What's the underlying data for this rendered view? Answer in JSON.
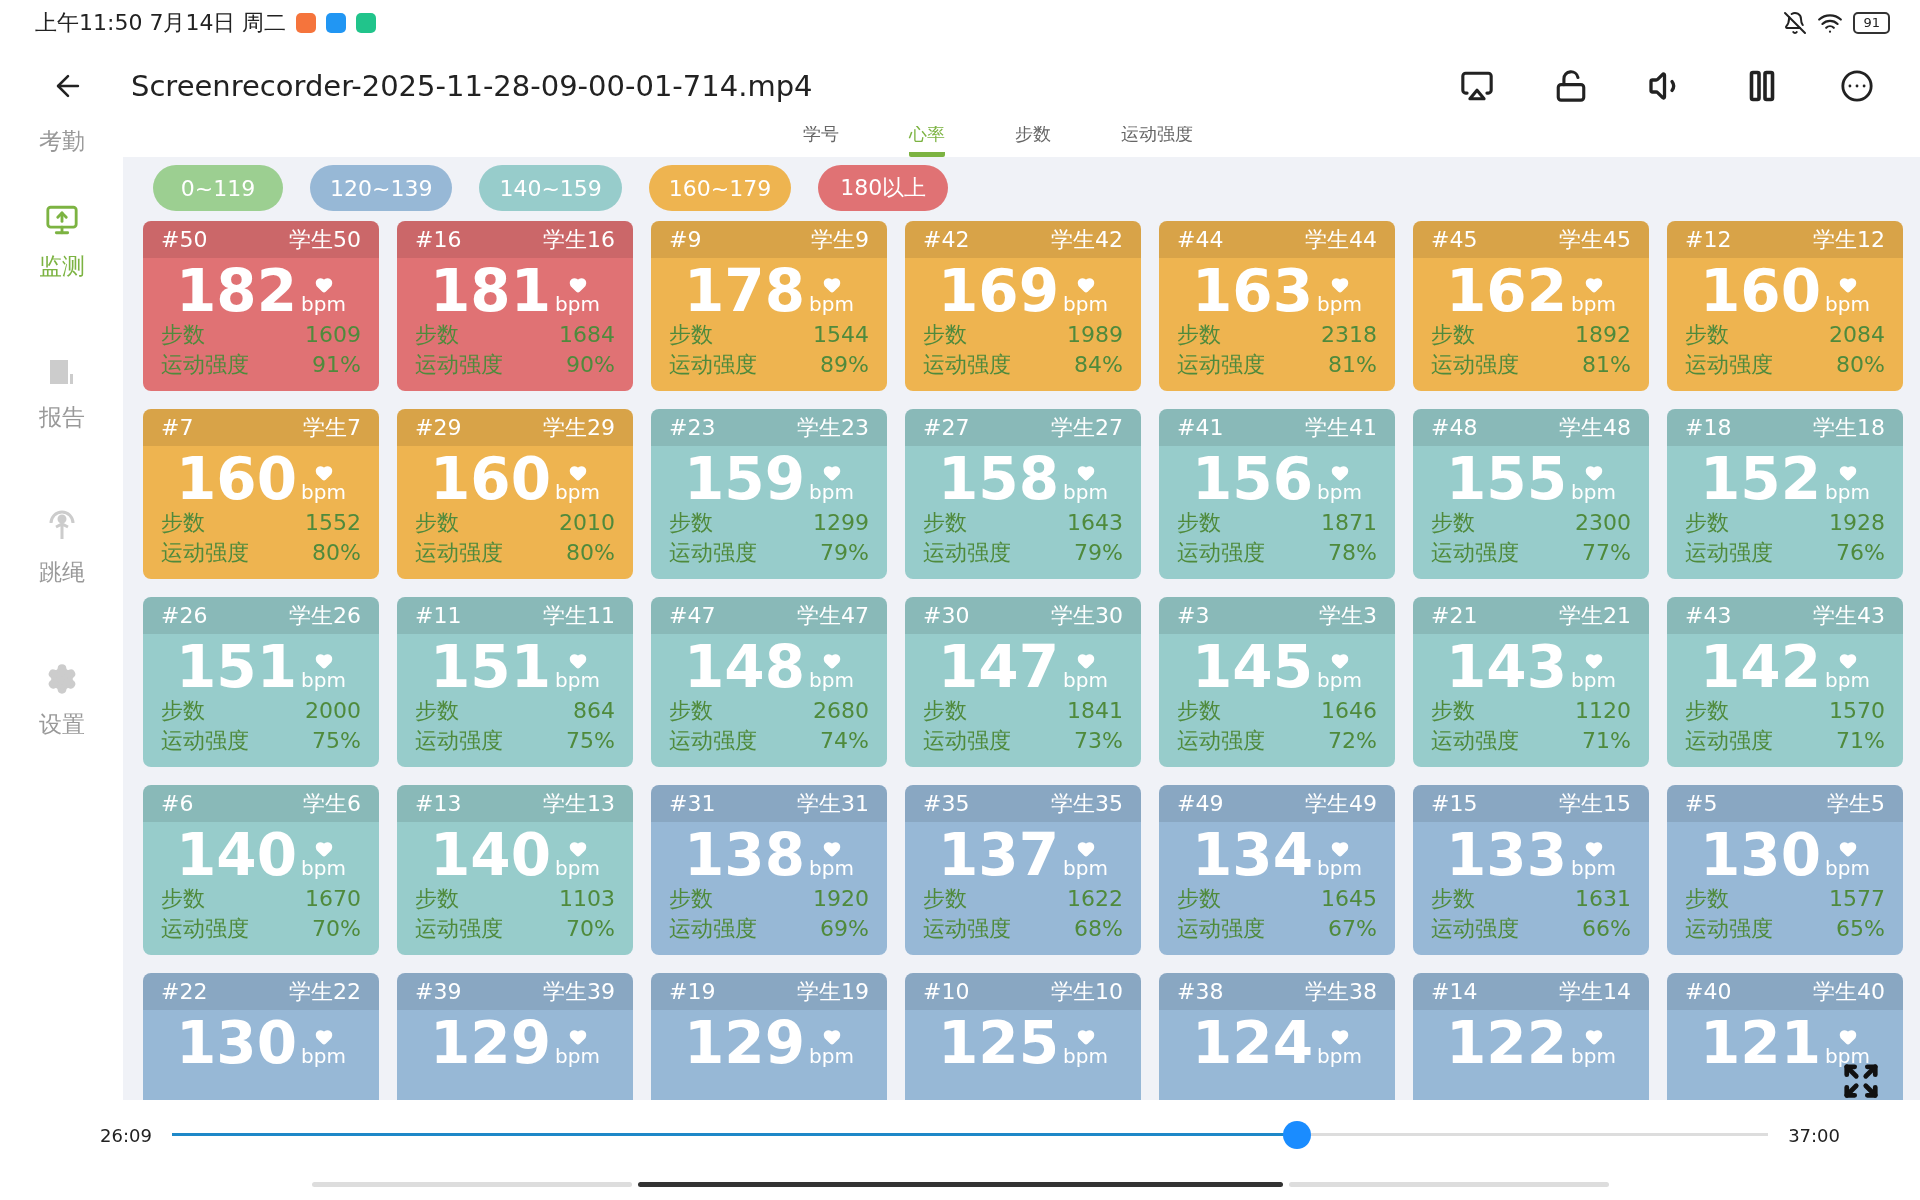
{
  "status_bar": {
    "time": "上午11:50 7月14日 周二",
    "battery": "91"
  },
  "player": {
    "title": "Screenrecorder-2025-11-28-09-00-01-714.mp4",
    "elapsed": "26:09",
    "duration": "37:00",
    "level": 0.705
  },
  "sidebar": {
    "items": [
      {
        "label": "考勤",
        "selected": false
      },
      {
        "label": "监测",
        "selected": true
      },
      {
        "label": "报告",
        "selected": false
      },
      {
        "label": "跳绳",
        "selected": false
      },
      {
        "label": "设置",
        "selected": false
      }
    ]
  },
  "tabs": [
    {
      "label": "学号",
      "selected": false
    },
    {
      "label": "心率",
      "selected": true
    },
    {
      "label": "步数",
      "selected": false
    },
    {
      "label": "运动强度",
      "selected": false
    }
  ],
  "legend": [
    {
      "label": "0~119",
      "color": "#9ccf91"
    },
    {
      "label": "120~139",
      "color": "#97b8d6"
    },
    {
      "label": "140~159",
      "color": "#97cccb"
    },
    {
      "label": "160~179",
      "color": "#eeb450"
    },
    {
      "label": "180以上",
      "color": "#e07274"
    }
  ],
  "cards": [
    {
      "id": "#50",
      "name": "学生50",
      "bpm": "182",
      "unit": "bpm",
      "steps_label": "步数",
      "steps": "1609",
      "intensity_label": "运动强度",
      "intensity": "91%",
      "color": "#e07274"
    },
    {
      "id": "#16",
      "name": "学生16",
      "bpm": "181",
      "unit": "bpm",
      "steps_label": "步数",
      "steps": "1684",
      "intensity_label": "运动强度",
      "intensity": "90%",
      "color": "#e07274"
    },
    {
      "id": "#9",
      "name": "学生9",
      "bpm": "178",
      "unit": "bpm",
      "steps_label": "步数",
      "steps": "1544",
      "intensity_label": "运动强度",
      "intensity": "89%",
      "color": "#eeb450"
    },
    {
      "id": "#42",
      "name": "学生42",
      "bpm": "169",
      "unit": "bpm",
      "steps_label": "步数",
      "steps": "1989",
      "intensity_label": "运动强度",
      "intensity": "84%",
      "color": "#eeb450"
    },
    {
      "id": "#44",
      "name": "学生44",
      "bpm": "163",
      "unit": "bpm",
      "steps_label": "步数",
      "steps": "2318",
      "intensity_label": "运动强度",
      "intensity": "81%",
      "color": "#eeb450"
    },
    {
      "id": "#45",
      "name": "学生45",
      "bpm": "162",
      "unit": "bpm",
      "steps_label": "步数",
      "steps": "1892",
      "intensity_label": "运动强度",
      "intensity": "81%",
      "color": "#eeb450"
    },
    {
      "id": "#12",
      "name": "学生12",
      "bpm": "160",
      "unit": "bpm",
      "steps_label": "步数",
      "steps": "2084",
      "intensity_label": "运动强度",
      "intensity": "80%",
      "color": "#eeb450"
    },
    {
      "id": "#7",
      "name": "学生7",
      "bpm": "160",
      "unit": "bpm",
      "steps_label": "步数",
      "steps": "1552",
      "intensity_label": "运动强度",
      "intensity": "80%",
      "color": "#eeb450"
    },
    {
      "id": "#29",
      "name": "学生29",
      "bpm": "160",
      "unit": "bpm",
      "steps_label": "步数",
      "steps": "2010",
      "intensity_label": "运动强度",
      "intensity": "80%",
      "color": "#eeb450"
    },
    {
      "id": "#23",
      "name": "学生23",
      "bpm": "159",
      "unit": "bpm",
      "steps_label": "步数",
      "steps": "1299",
      "intensity_label": "运动强度",
      "intensity": "79%",
      "color": "#97cccb"
    },
    {
      "id": "#27",
      "name": "学生27",
      "bpm": "158",
      "unit": "bpm",
      "steps_label": "步数",
      "steps": "1643",
      "intensity_label": "运动强度",
      "intensity": "79%",
      "color": "#97cccb"
    },
    {
      "id": "#41",
      "name": "学生41",
      "bpm": "156",
      "unit": "bpm",
      "steps_label": "步数",
      "steps": "1871",
      "intensity_label": "运动强度",
      "intensity": "78%",
      "color": "#97cccb"
    },
    {
      "id": "#48",
      "name": "学生48",
      "bpm": "155",
      "unit": "bpm",
      "steps_label": "步数",
      "steps": "2300",
      "intensity_label": "运动强度",
      "intensity": "77%",
      "color": "#97cccb"
    },
    {
      "id": "#18",
      "name": "学生18",
      "bpm": "152",
      "unit": "bpm",
      "steps_label": "步数",
      "steps": "1928",
      "intensity_label": "运动强度",
      "intensity": "76%",
      "color": "#97cccb"
    },
    {
      "id": "#26",
      "name": "学生26",
      "bpm": "151",
      "unit": "bpm",
      "steps_label": "步数",
      "steps": "2000",
      "intensity_label": "运动强度",
      "intensity": "75%",
      "color": "#97cccb"
    },
    {
      "id": "#11",
      "name": "学生11",
      "bpm": "151",
      "unit": "bpm",
      "steps_label": "步数",
      "steps": "864",
      "intensity_label": "运动强度",
      "intensity": "75%",
      "color": "#97cccb"
    },
    {
      "id": "#47",
      "name": "学生47",
      "bpm": "148",
      "unit": "bpm",
      "steps_label": "步数",
      "steps": "2680",
      "intensity_label": "运动强度",
      "intensity": "74%",
      "color": "#97cccb"
    },
    {
      "id": "#30",
      "name": "学生30",
      "bpm": "147",
      "unit": "bpm",
      "steps_label": "步数",
      "steps": "1841",
      "intensity_label": "运动强度",
      "intensity": "73%",
      "color": "#97cccb"
    },
    {
      "id": "#3",
      "name": "学生3",
      "bpm": "145",
      "unit": "bpm",
      "steps_label": "步数",
      "steps": "1646",
      "intensity_label": "运动强度",
      "intensity": "72%",
      "color": "#97cccb"
    },
    {
      "id": "#21",
      "name": "学生21",
      "bpm": "143",
      "unit": "bpm",
      "steps_label": "步数",
      "steps": "1120",
      "intensity_label": "运动强度",
      "intensity": "71%",
      "color": "#97cccb"
    },
    {
      "id": "#43",
      "name": "学生43",
      "bpm": "142",
      "unit": "bpm",
      "steps_label": "步数",
      "steps": "1570",
      "intensity_label": "运动强度",
      "intensity": "71%",
      "color": "#97cccb"
    },
    {
      "id": "#6",
      "name": "学生6",
      "bpm": "140",
      "unit": "bpm",
      "steps_label": "步数",
      "steps": "1670",
      "intensity_label": "运动强度",
      "intensity": "70%",
      "color": "#97cccb"
    },
    {
      "id": "#13",
      "name": "学生13",
      "bpm": "140",
      "unit": "bpm",
      "steps_label": "步数",
      "steps": "1103",
      "intensity_label": "运动强度",
      "intensity": "70%",
      "color": "#97cccb"
    },
    {
      "id": "#31",
      "name": "学生31",
      "bpm": "138",
      "unit": "bpm",
      "steps_label": "步数",
      "steps": "1920",
      "intensity_label": "运动强度",
      "intensity": "69%",
      "color": "#97b8d6"
    },
    {
      "id": "#35",
      "name": "学生35",
      "bpm": "137",
      "unit": "bpm",
      "steps_label": "步数",
      "steps": "1622",
      "intensity_label": "运动强度",
      "intensity": "68%",
      "color": "#97b8d6"
    },
    {
      "id": "#49",
      "name": "学生49",
      "bpm": "134",
      "unit": "bpm",
      "steps_label": "步数",
      "steps": "1645",
      "intensity_label": "运动强度",
      "intensity": "67%",
      "color": "#97b8d6"
    },
    {
      "id": "#15",
      "name": "学生15",
      "bpm": "133",
      "unit": "bpm",
      "steps_label": "步数",
      "steps": "1631",
      "intensity_label": "运动强度",
      "intensity": "66%",
      "color": "#97b8d6"
    },
    {
      "id": "#5",
      "name": "学生5",
      "bpm": "130",
      "unit": "bpm",
      "steps_label": "步数",
      "steps": "1577",
      "intensity_label": "运动强度",
      "intensity": "65%",
      "color": "#97b8d6"
    },
    {
      "id": "#22",
      "name": "学生22",
      "bpm": "130",
      "unit": "bpm",
      "color": "#97b8d6"
    },
    {
      "id": "#39",
      "name": "学生39",
      "bpm": "129",
      "unit": "bpm",
      "color": "#97b8d6"
    },
    {
      "id": "#19",
      "name": "学生19",
      "bpm": "129",
      "unit": "bpm",
      "color": "#97b8d6"
    },
    {
      "id": "#10",
      "name": "学生10",
      "bpm": "125",
      "unit": "bpm",
      "color": "#97b8d6"
    },
    {
      "id": "#38",
      "name": "学生38",
      "bpm": "124",
      "unit": "bpm",
      "color": "#97b8d6"
    },
    {
      "id": "#14",
      "name": "学生14",
      "bpm": "122",
      "unit": "bpm",
      "color": "#97b8d6"
    },
    {
      "id": "#40",
      "name": "学生40",
      "bpm": "121",
      "unit": "bpm",
      "color": "#97b8d6"
    }
  ]
}
